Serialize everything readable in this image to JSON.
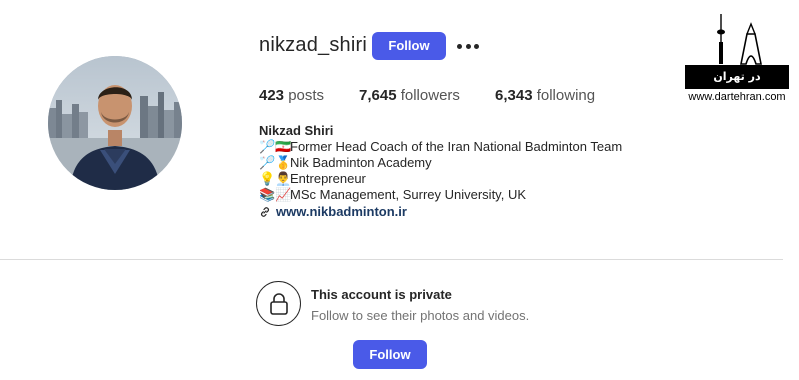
{
  "profile": {
    "username": "nikzad_shiri",
    "follow_label": "Follow",
    "more_icon": "more-horizontal-icon",
    "stats": {
      "posts_count": "423",
      "posts_label": "posts",
      "followers_count": "7,645",
      "followers_label": "followers",
      "following_count": "6,343",
      "following_label": "following"
    },
    "full_name": "Nikzad Shiri",
    "bio": [
      {
        "emoji": "🏸🇮🇷",
        "text": "Former Head Coach of the Iran National Badminton Team"
      },
      {
        "emoji": "🏸🥇",
        "text": "Nik Badminton Academy"
      },
      {
        "emoji": "💡👨‍💼",
        "text": "Entrepreneur"
      },
      {
        "emoji": "📚📈",
        "text": "MSc Management, Surrey University, UK"
      }
    ],
    "link": "www.nikbadminton.ir"
  },
  "private_notice": {
    "title": "This account is private",
    "subtitle": "Follow to see their photos and videos.",
    "follow_label": "Follow",
    "icon": "lock-icon"
  },
  "watermark": {
    "brand": "در تهران",
    "url": "www.dartehran.com"
  },
  "colors": {
    "accent": "#4a5ae8",
    "text": "#262626",
    "secondary_text": "#737373",
    "link": "#1c3a63",
    "divider": "#dbdbdb"
  }
}
